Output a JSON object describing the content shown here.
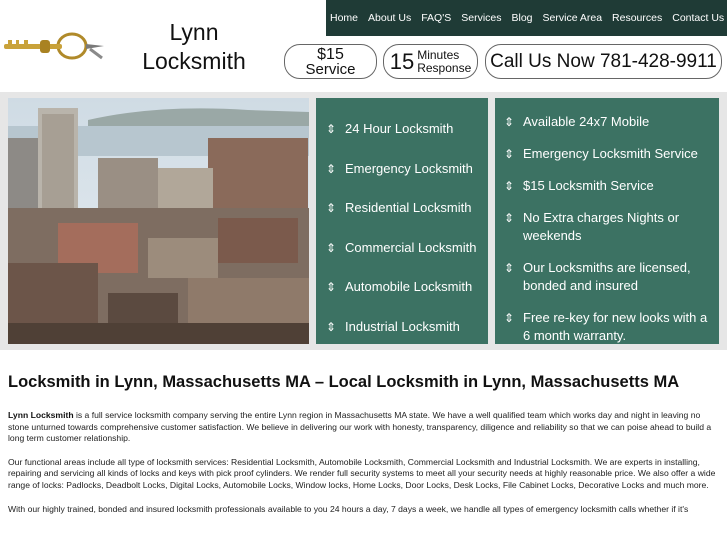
{
  "brand": {
    "name_line1": "Lynn",
    "name_line2": "Locksmith"
  },
  "nav": [
    "Home",
    "About Us",
    "FAQ'S",
    "Services",
    "Blog",
    "Service Area",
    "Resources",
    "Contact Us"
  ],
  "badges": {
    "price_top": "$15",
    "price_bottom": "Service",
    "response_num": "15",
    "response_top": "Minutes",
    "response_bottom": "Response",
    "call": "Call Us Now 781-428-9911"
  },
  "panel_left": [
    "24 Hour Locksmith",
    "Emergency Locksmith",
    "Residential Locksmith",
    "Commercial Locksmith",
    "Automobile Locksmith",
    "Industrial Locksmith"
  ],
  "panel_right": [
    "Available 24x7 Mobile",
    "Emergency Locksmith Service",
    "$15 Locksmith Service",
    "No Extra charges Nights or weekends",
    "Our Locksmiths are licensed, bonded and insured",
    "Free re-key for new looks with a 6 month warranty."
  ],
  "article": {
    "title": "Locksmith in Lynn, Massachusetts MA – Local Locksmith in Lynn, Massachusetts MA",
    "p1_bold": "Lynn Locksmith",
    "p1": " is a full service locksmith company serving the entire Lynn region in Massachusetts MA state. We have a well qualified team which works day and night in leaving no stone unturned towards comprehensive customer satisfaction. We believe in delivering our work with honesty, transparency, diligence and reliability so that we can poise ahead to build a long term customer relationship.",
    "p2": "Our functional areas include all type of locksmith services: Residential Locksmith, Automobile Locksmith, Commercial Locksmith and Industrial Locksmith. We are experts in installing, repairing and servicing all kinds of locks and keys with pick proof cylinders. We render full security systems to meet all your security needs at highly reasonable price. We also offer a wide range of locks: Padlocks, Deadbolt Locks, Digital Locks, Automobile Locks, Window locks, Home Locks, Door Locks, Desk Locks, File Cabinet Locks, Decorative Locks and much more.",
    "p3": "With our highly trained, bonded and insured locksmith professionals available to you 24 hours a day, 7 days a week, we handle all types of emergency locksmith calls whether if it's"
  },
  "colors": {
    "nav_bg": "#1f3b36",
    "panel_bg": "#3c7263",
    "band_bg": "#e6e6e6"
  }
}
